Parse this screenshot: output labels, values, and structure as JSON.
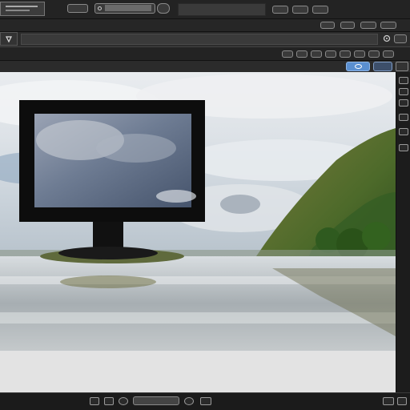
{
  "toolbar": {
    "tab_1": "",
    "tab_2": "",
    "search_value": ""
  },
  "options_bar": {
    "tool_value": "",
    "right_buttons": [
      "",
      "",
      ""
    ]
  },
  "panel_bar": {
    "buttons": [
      "",
      "",
      "",
      "",
      "",
      "",
      "",
      ""
    ]
  },
  "status_bar": {
    "zoom_value": ""
  },
  "colors": {
    "app_bg": "#1e1e1e",
    "panel_bg": "#2b2b2b",
    "accent": "#5a8fd0"
  },
  "icons": [
    "menu-icon",
    "dropdown-arrow-icon",
    "layers-icon",
    "settings-icon",
    "eye-icon",
    "zoom-icon",
    "play-icon",
    "record-icon"
  ]
}
